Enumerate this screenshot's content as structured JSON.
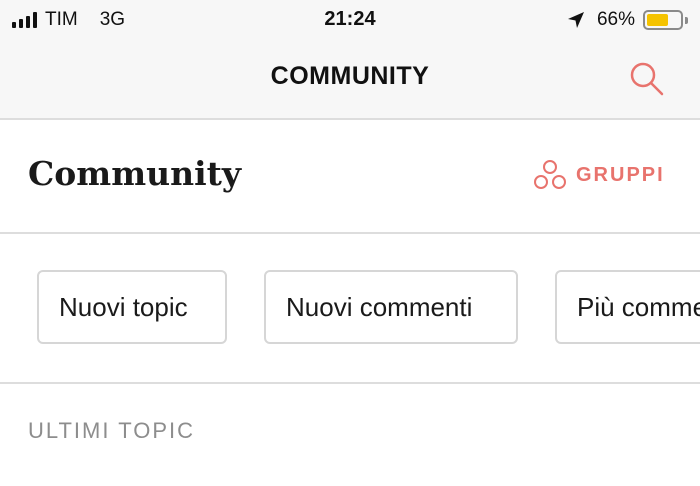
{
  "status_bar": {
    "carrier": "TIM",
    "network": "3G",
    "time": "21:24",
    "battery_percent": "66%",
    "battery_level": 0.66,
    "battery_color": "#f5c300"
  },
  "nav": {
    "title": "COMMUNITY",
    "search_icon": "search-icon"
  },
  "header": {
    "title": "Community",
    "groups_label": "GRUPPI",
    "groups_icon": "groups-icon",
    "accent_color": "#e8736d"
  },
  "filters": [
    {
      "label": "Nuovi topic"
    },
    {
      "label": "Nuovi commenti"
    },
    {
      "label": "Più commentati"
    }
  ],
  "section": {
    "label": "ULTIMI TOPIC"
  }
}
